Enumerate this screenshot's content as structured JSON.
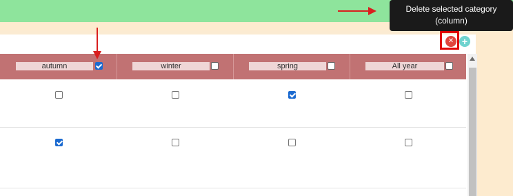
{
  "tooltip": {
    "line1": "Delete selected category",
    "line2": "(column)"
  },
  "actions": {
    "delete_icon": "close-icon",
    "delete_glyph": "✕",
    "add_icon": "plus-icon",
    "add_glyph": "+"
  },
  "columns": [
    {
      "label": "autumn",
      "selected": true
    },
    {
      "label": "winter",
      "selected": false
    },
    {
      "label": "spring",
      "selected": false
    },
    {
      "label": "All year",
      "selected": false
    }
  ],
  "rows": [
    {
      "cells": [
        false,
        false,
        true,
        false
      ]
    },
    {
      "cells": [
        true,
        false,
        false,
        false
      ]
    }
  ],
  "colors": {
    "header_bg": "#c17273",
    "checkbox_checked": "#1b6ad0",
    "delete_button": "#e0443c",
    "add_button": "#6fd3cf",
    "annotation": "#d91e1e"
  }
}
